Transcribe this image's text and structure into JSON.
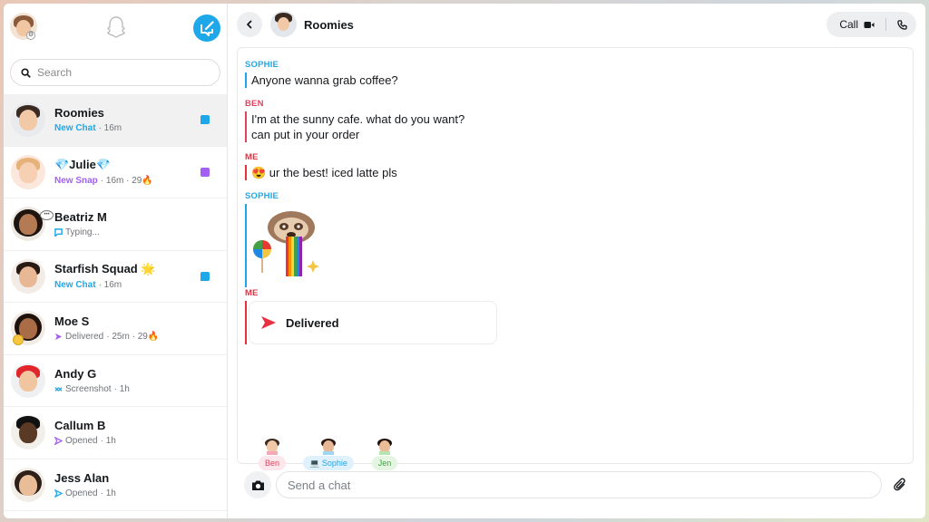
{
  "sidebar": {
    "search_placeholder": "Search",
    "chats": [
      {
        "name": "Roomies",
        "status_label": "New Chat",
        "status_time": " · 16m",
        "status_color": "#1ea8ea",
        "marker": "chat",
        "marker_color": "#1ea8ea",
        "active": true
      },
      {
        "name": "💎Julie💎",
        "status_label": "New Snap",
        "status_time": " · 16m · 29🔥",
        "status_color": "#a25ff1",
        "marker": "snap",
        "marker_color": "#a25ff1"
      },
      {
        "name": "Beatriz M",
        "status_label": "Typing...",
        "status_time": "",
        "status_color": "#6f7378",
        "icon": "typing-icon"
      },
      {
        "name": "Starfish Squad 🌟",
        "status_label": "New Chat",
        "status_time": " · 16m",
        "status_color": "#1ea8ea",
        "marker": "chat",
        "marker_color": "#1ea8ea"
      },
      {
        "name": "Moe S",
        "status_label": "Delivered",
        "status_time": " · 25m · 29🔥",
        "status_color": "#6f7378",
        "icon": "delivered-purple-arrow-icon"
      },
      {
        "name": "Andy G",
        "status_label": "Screenshot",
        "status_time": " · 1h",
        "status_color": "#6f7378",
        "icon": "screenshot-icon"
      },
      {
        "name": "Callum B",
        "status_label": "Opened",
        "status_time": " · 1h",
        "status_color": "#6f7378",
        "icon": "opened-purple-arrow-icon"
      },
      {
        "name": "Jess Alan",
        "status_label": "Opened",
        "status_time": " · 1h",
        "status_color": "#6f7378",
        "icon": "opened-blue-arrow-icon"
      }
    ]
  },
  "header": {
    "title": "Roomies",
    "call_label": "Call"
  },
  "messages": [
    {
      "sender": "SOPHIE",
      "lines": [
        "Anyone wanna grab coffee?"
      ]
    },
    {
      "sender": "BEN",
      "lines": [
        "I'm at the sunny cafe. what do you want?",
        "can put in your order"
      ]
    },
    {
      "sender": "ME",
      "lines": [
        "😍 ur the best! iced latte pls"
      ]
    },
    {
      "sender": "SOPHIE",
      "sticker": "sloth-rainbow-sticker"
    },
    {
      "sender": "ME",
      "delivered_label": "Delivered"
    }
  ],
  "presence": [
    {
      "name": "Ben"
    },
    {
      "name": "Sophie"
    },
    {
      "name": "Jen"
    }
  ],
  "composer": {
    "placeholder": "Send a chat"
  },
  "colors": {
    "snap_blue": "#1ea8ea",
    "snap_red": "#e8313f",
    "snap_purple": "#a25ff1",
    "ben_pink": "#e2425f"
  }
}
